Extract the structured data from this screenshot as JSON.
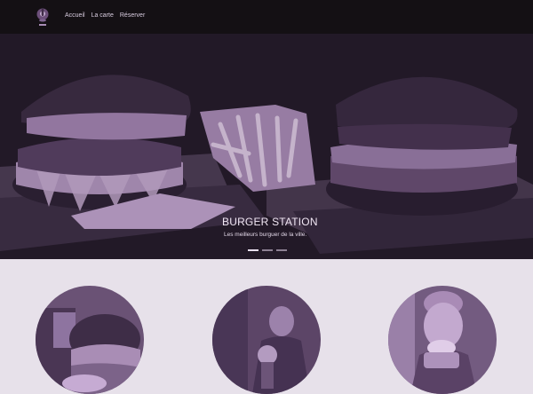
{
  "nav": {
    "logo_icon": "chef-logo-icon",
    "links": [
      {
        "label": "Accueil"
      },
      {
        "label": "La carte"
      },
      {
        "label": "Réserver"
      }
    ]
  },
  "hero": {
    "title": "BURGER STATION",
    "subtitle": "Les meilleurs burguer de la ville.",
    "carousel": {
      "slide_count": 3,
      "active_index": 0
    }
  },
  "colors": {
    "navbar": "#141014",
    "hero_tint": "#271d2c",
    "page_background": "#e7e1ea",
    "accent_purple": "#6c5377"
  }
}
